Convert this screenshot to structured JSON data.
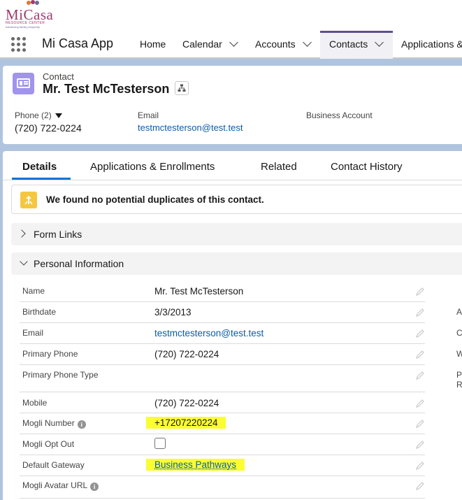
{
  "brand": {
    "logo_word": "MiCasa",
    "logo_sub": "RESOURCE CENTER",
    "logo_tag": "Advancing family prosperity"
  },
  "app": {
    "name": "Mi Casa App"
  },
  "nav": [
    {
      "label": "Home",
      "has_menu": false,
      "active": false
    },
    {
      "label": "Calendar",
      "has_menu": true,
      "active": false
    },
    {
      "label": "Accounts",
      "has_menu": true,
      "active": false
    },
    {
      "label": "Contacts",
      "has_menu": true,
      "active": true
    },
    {
      "label": "Applications &",
      "has_menu": false,
      "active": false
    }
  ],
  "record": {
    "type": "Contact",
    "name": "Mr. Test McTesterson",
    "highlights": {
      "phone_label": "Phone (2)",
      "phone_value": "(720) 722-0224",
      "email_label": "Email",
      "email_value": "testmctesterson@test.test",
      "business_account_label": "Business Account"
    }
  },
  "tabs": [
    "Details",
    "Applications & Enrollments",
    "Related",
    "Contact History"
  ],
  "duplicate_alert": "We found no potential duplicates of this contact.",
  "sections": {
    "form_links": "Form Links",
    "personal_info": "Personal Information"
  },
  "fields": [
    {
      "label": "Name",
      "value": "Mr. Test McTesterson"
    },
    {
      "label": "Birthdate",
      "value": "3/3/2013"
    },
    {
      "label": "Email",
      "value": "testmctesterson@test.test"
    },
    {
      "label": "Primary Phone",
      "value": "(720) 722-0224"
    },
    {
      "label": "Primary Phone Type",
      "value": ""
    },
    {
      "label": "Mobile",
      "value": "(720) 722-0224"
    },
    {
      "label": "Mogli Number",
      "value": "+17207220224"
    },
    {
      "label": "Mogli Opt Out",
      "value": ""
    },
    {
      "label": "Default Gateway",
      "value": "Business Pathways"
    },
    {
      "label": "Mogli Avatar URL",
      "value": ""
    }
  ],
  "right_column_fragments": [
    "A",
    "C",
    "W",
    "P",
    "R"
  ],
  "colors": {
    "brand_purple": "#5e4e8f",
    "contact_icon": "#a094ed",
    "link": "#0b5cab",
    "highlight": "#fbff2f",
    "tab_accent": "#0176d3"
  }
}
